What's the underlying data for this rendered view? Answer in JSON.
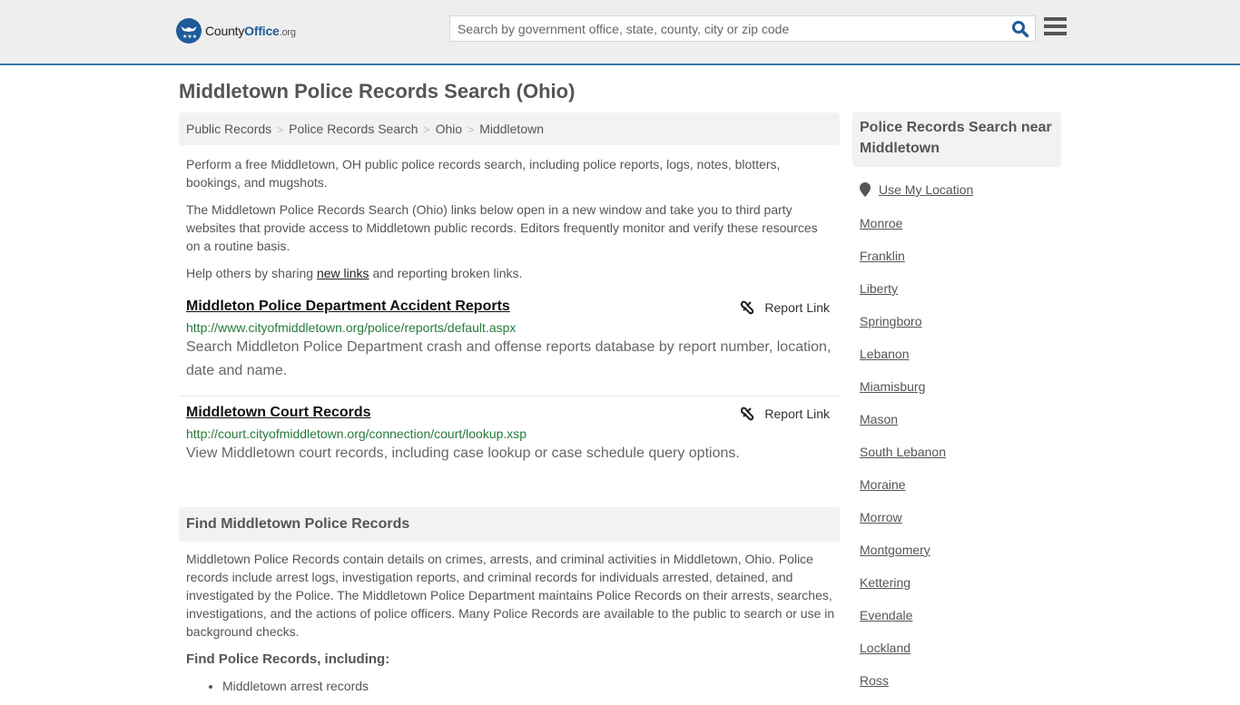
{
  "header": {
    "logo": {
      "name": "County",
      "name_bold": "Office",
      "tld": ".org"
    },
    "search": {
      "placeholder": "Search by government office, state, county, city or zip code",
      "value": ""
    },
    "icons": {
      "search": "search-icon",
      "menu": "hamburger-menu-icon"
    },
    "accent_color": "#3a7aa9"
  },
  "page": {
    "title": "Middletown Police Records Search (Ohio)",
    "breadcrumb": [
      "Public Records",
      "Police Records Search",
      "Ohio",
      "Middletown"
    ],
    "breadcrumb_separator": ">"
  },
  "intro": {
    "p1": "Perform a free Middletown, OH public police records search, including police reports, logs, notes, blotters, bookings, and mugshots.",
    "p2": "The Middletown Police Records Search (Ohio) links below open in a new window and take you to third party websites that provide access to Middletown public records. Editors frequently monitor and verify these resources on a routine basis.",
    "p3_before": "Help others by sharing ",
    "p3_link": "new links",
    "p3_after": " and reporting broken links."
  },
  "results": [
    {
      "title": "Middleton Police Department Accident Reports",
      "url": "http://www.cityofmiddletown.org/police/reports/default.aspx",
      "description": "Search Middleton Police Department crash and offense reports database by report number, location, date and name.",
      "report_label": "Report Link"
    },
    {
      "title": "Middletown Court Records",
      "url": "http://court.cityofmiddletown.org/connection/court/lookup.xsp",
      "description": "View Middletown court records, including case lookup or case schedule query options.",
      "report_label": "Report Link"
    }
  ],
  "find_section": {
    "heading": "Find Middletown Police Records",
    "body": "Middletown Police Records contain details on crimes, arrests, and criminal activities in Middletown, Ohio. Police records include arrest logs, investigation reports, and criminal records for individuals arrested, detained, and investigated by the Police. The Middletown Police Department maintains Police Records on their arrests, searches, investigations, and the actions of police officers. Many Police Records are available to the public to search or use in background checks.",
    "subheading": "Find Police Records, including:",
    "bullets": [
      "Middletown arrest records"
    ]
  },
  "sidebar": {
    "heading": "Police Records Search near Middletown",
    "use_location": "Use My Location",
    "places": [
      "Monroe",
      "Franklin",
      "Liberty",
      "Springboro",
      "Lebanon",
      "Miamisburg",
      "Mason",
      "South Lebanon",
      "Moraine",
      "Morrow",
      "Montgomery",
      "Kettering",
      "Evendale",
      "Lockland",
      "Ross"
    ]
  }
}
